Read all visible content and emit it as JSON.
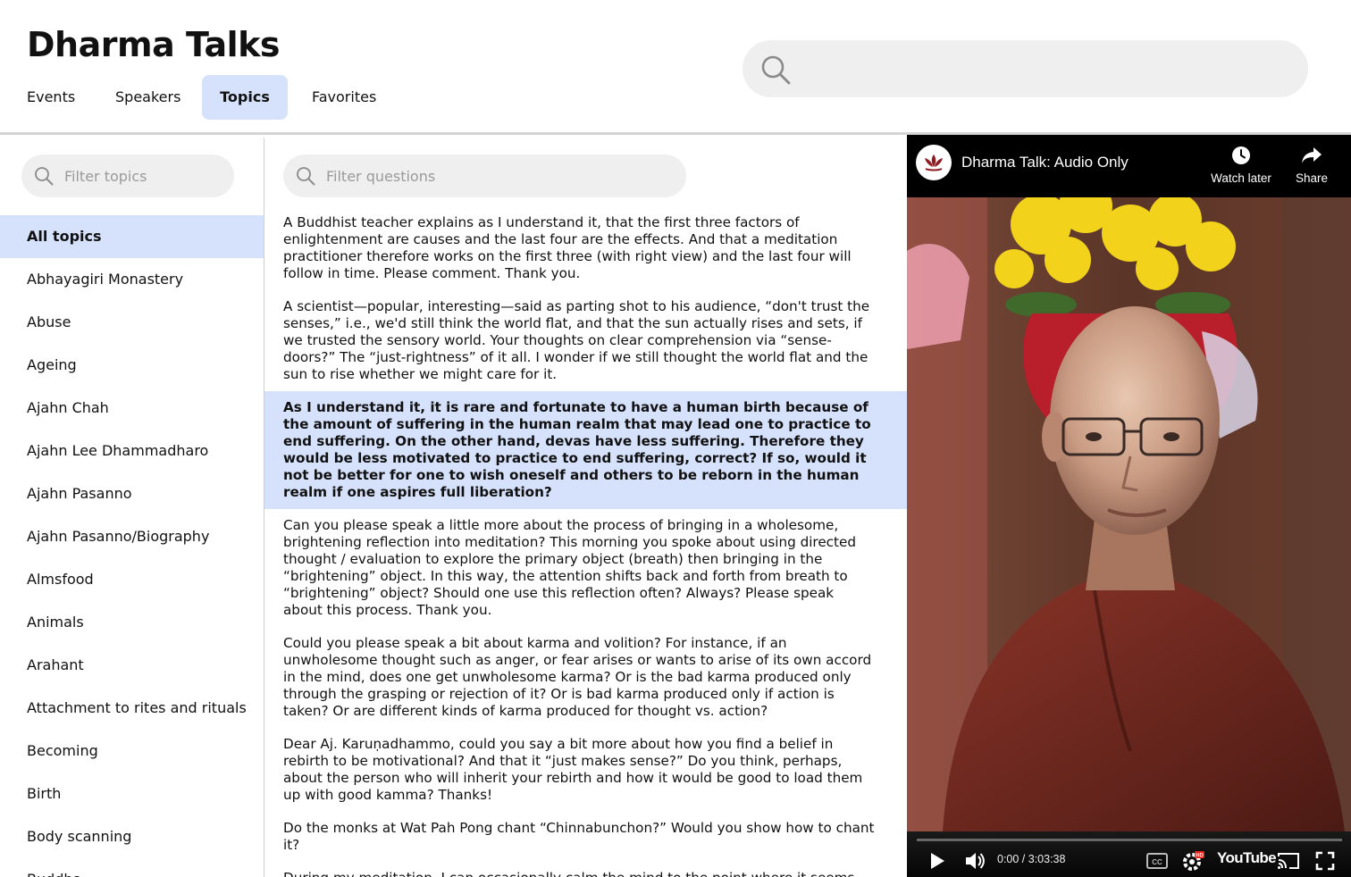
{
  "app": {
    "title": "Dharma Talks"
  },
  "nav": {
    "tabs": [
      "Events",
      "Speakers",
      "Topics",
      "Favorites"
    ],
    "active": "Topics"
  },
  "search": {
    "placeholder": ""
  },
  "topics": {
    "filter_placeholder": "Filter topics",
    "items": [
      "All topics",
      "Abhayagiri Monastery",
      "Abuse",
      "Ageing",
      "Ajahn Chah",
      "Ajahn Lee Dhammadharo",
      "Ajahn Pasanno",
      "Ajahn Pasanno/Biography",
      "Almsfood",
      "Animals",
      "Arahant",
      "Attachment to rites and rituals",
      "Becoming",
      "Birth",
      "Body scanning",
      "Buddha"
    ],
    "active": "All topics"
  },
  "questions": {
    "filter_placeholder": "Filter questions",
    "items": [
      "A Buddhist teacher explains as I understand it, that the first three factors of enlightenment are causes and the last four are the effects. And that a meditation practitioner therefore works on the first three (with right view) and the last four will follow in time. Please comment. Thank you.",
      "A scientist—popular, interesting—said as parting shot to his audience, “don't trust the senses,” i.e., we'd still think the world flat, and that the sun actually rises and sets, if we trusted the sensory world. Your thoughts on clear comprehension via “sense-doors?” The “just-rightness” of it all. I wonder if we still thought the world flat and the sun to rise whether we might care for it.",
      "As I understand it, it is rare and fortunate to have a human birth because of the amount of suffering in the human realm that may lead one to practice to end suffering. On the other hand, devas have less suffering. Therefore they would be less motivated to practice to end suffering, correct? If so, would it not be better for one to wish oneself and others to be reborn in the human realm if one aspires full liberation?",
      "Can you please speak a little more about the process of bringing in a wholesome, brightening reflection into meditation? This morning you spoke about using directed thought / evaluation to explore the primary object (breath) then bringing in the “brightening” object. In this way, the attention shifts back and forth from breath to “brightening” object? Should one use this reflection often? Always? Please speak about this process. Thank you.",
      "Could you please speak a bit about karma and volition? For instance, if an unwholesome thought such as anger, or fear arises or wants to arise of its own accord in the mind, does one get unwholesome karma? Or is the bad karma produced only through the grasping or rejection of it? Or is bad karma produced only if action is taken? Or are different kinds of karma produced for thought vs. action?",
      "Dear Aj. Karuṇadhammo, could you say a bit more about how you find a belief in rebirth to be motivational? And that it “just makes sense?”  Do you think, perhaps, about the person who will inherit your rebirth and how it would be good to load them up with good kamma? Thanks!",
      "Do the monks at Wat Pah Pong chant “Chinnabunchon?” Would you show how to chant it?",
      "During my meditation, I can occasionally calm the mind to the point where it seems"
    ],
    "selected_index": 2
  },
  "player": {
    "title": "Dharma Talk: Audio Only",
    "watch_later": "Watch later",
    "share": "Share",
    "time": "0:00 / 3:03:38",
    "brand": "YouTube",
    "progress": 0,
    "icons": [
      "play-icon",
      "volume-icon",
      "captions-icon",
      "settings-icon",
      "cast-icon",
      "fullscreen-icon",
      "clock-icon",
      "share-icon"
    ]
  }
}
